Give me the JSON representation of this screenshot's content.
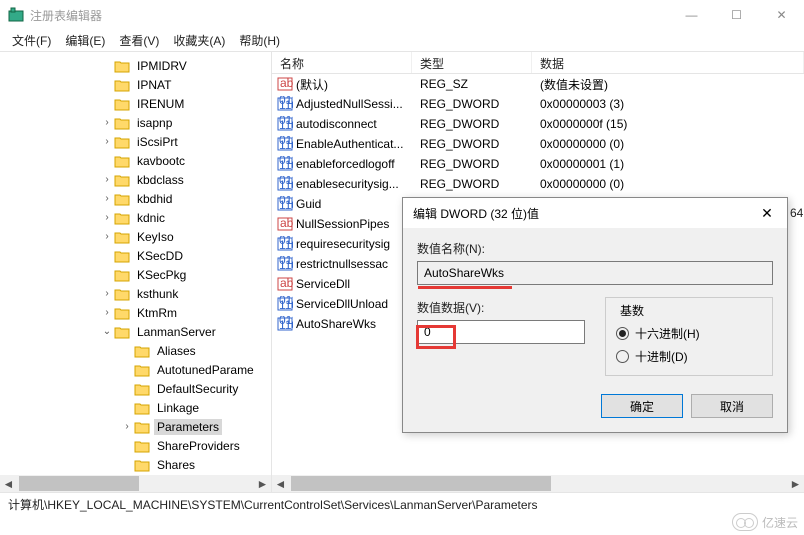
{
  "window": {
    "title": "注册表编辑器",
    "min": "—",
    "max": "☐",
    "close": "✕"
  },
  "menu": [
    "文件(F)",
    "编辑(E)",
    "查看(V)",
    "收藏夹(A)",
    "帮助(H)"
  ],
  "tree": [
    {
      "indent": 100,
      "exp": "",
      "label": "IPMIDRV"
    },
    {
      "indent": 100,
      "exp": "",
      "label": "IPNAT"
    },
    {
      "indent": 100,
      "exp": "",
      "label": "IRENUM"
    },
    {
      "indent": 100,
      "exp": ">",
      "label": "isapnp"
    },
    {
      "indent": 100,
      "exp": ">",
      "label": "iScsiPrt"
    },
    {
      "indent": 100,
      "exp": "",
      "label": "kavbootc"
    },
    {
      "indent": 100,
      "exp": ">",
      "label": "kbdclass"
    },
    {
      "indent": 100,
      "exp": ">",
      "label": "kbdhid"
    },
    {
      "indent": 100,
      "exp": ">",
      "label": "kdnic"
    },
    {
      "indent": 100,
      "exp": ">",
      "label": "KeyIso"
    },
    {
      "indent": 100,
      "exp": "",
      "label": "KSecDD"
    },
    {
      "indent": 100,
      "exp": "",
      "label": "KSecPkg"
    },
    {
      "indent": 100,
      "exp": ">",
      "label": "ksthunk"
    },
    {
      "indent": 100,
      "exp": ">",
      "label": "KtmRm"
    },
    {
      "indent": 100,
      "exp": "v",
      "label": "LanmanServer"
    },
    {
      "indent": 120,
      "exp": "",
      "label": "Aliases"
    },
    {
      "indent": 120,
      "exp": "",
      "label": "AutotunedParame"
    },
    {
      "indent": 120,
      "exp": "",
      "label": "DefaultSecurity"
    },
    {
      "indent": 120,
      "exp": "",
      "label": "Linkage"
    },
    {
      "indent": 120,
      "exp": ">",
      "label": "Parameters",
      "selected": true
    },
    {
      "indent": 120,
      "exp": "",
      "label": "ShareProviders"
    },
    {
      "indent": 120,
      "exp": "",
      "label": "Shares"
    }
  ],
  "columns": {
    "name": "名称",
    "type": "类型",
    "data": "数据"
  },
  "rows": [
    {
      "icon": "str",
      "name": "(默认)",
      "type": "REG_SZ",
      "data": "(数值未设置)"
    },
    {
      "icon": "dw",
      "name": "AdjustedNullSessi...",
      "type": "REG_DWORD",
      "data": "0x00000003 (3)"
    },
    {
      "icon": "dw",
      "name": "autodisconnect",
      "type": "REG_DWORD",
      "data": "0x0000000f (15)"
    },
    {
      "icon": "dw",
      "name": "EnableAuthenticat...",
      "type": "REG_DWORD",
      "data": "0x00000000 (0)"
    },
    {
      "icon": "dw",
      "name": "enableforcedlogoff",
      "type": "REG_DWORD",
      "data": "0x00000001 (1)"
    },
    {
      "icon": "dw",
      "name": "enablesecuritysig...",
      "type": "REG_DWORD",
      "data": "0x00000000 (0)"
    },
    {
      "icon": "dw",
      "name": "Guid",
      "type": "",
      "data": ""
    },
    {
      "icon": "str",
      "name": "NullSessionPipes",
      "type": "",
      "data": ""
    },
    {
      "icon": "dw",
      "name": "requiresecuritysig",
      "type": "",
      "data": ""
    },
    {
      "icon": "dw",
      "name": "restrictnullsessac",
      "type": "",
      "data": ""
    },
    {
      "icon": "str",
      "name": "ServiceDll",
      "type": "",
      "data": ""
    },
    {
      "icon": "dw",
      "name": "ServiceDllUnload",
      "type": "",
      "data": ""
    },
    {
      "icon": "dw",
      "name": "AutoShareWks",
      "type": "",
      "data": ""
    }
  ],
  "dialog": {
    "title": "编辑 DWORD (32 位)值",
    "name_label": "数值名称(N):",
    "name_value": "AutoShareWks",
    "data_label": "数值数据(V):",
    "data_value": "0",
    "base_label": "基数",
    "radix_hex": "十六进制(H)",
    "radix_dec": "十进制(D)",
    "ok": "确定",
    "cancel": "取消"
  },
  "status": "计算机\\HKEY_LOCAL_MACHINE\\SYSTEM\\CurrentControlSet\\Services\\LanmanServer\\Parameters",
  "truncated": "64",
  "watermark": "亿速云"
}
